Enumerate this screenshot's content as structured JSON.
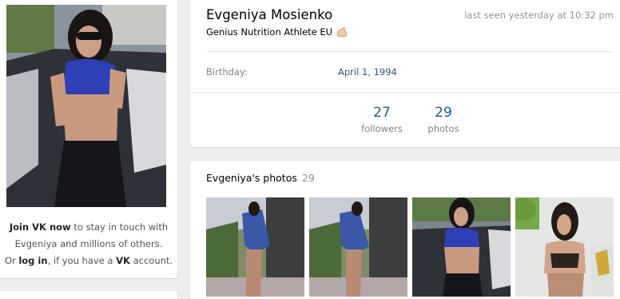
{
  "sidebar": {
    "join_strong": "Join VK now",
    "join_rest": " to stay in touch with",
    "line2": "Evgeniya and millions of others.",
    "line3_or": "Or ",
    "line3_login": "log in",
    "line3_mid": ", if you have a ",
    "line3_vk": "VK",
    "line3_end": " account."
  },
  "profile": {
    "name": "Evgeniya Mosienko",
    "status": "Genius Nutrition Athlete EU",
    "status_emoji": "muscle-emoji",
    "last_seen": "last seen yesterday at 10:32 pm",
    "birthday_label": "Birthday:",
    "birthday_value": "April 1, 1994",
    "counters": [
      {
        "number": "27",
        "label": "followers"
      },
      {
        "number": "29",
        "label": "photos"
      }
    ]
  },
  "photos": {
    "title": "Evgeniya's photos",
    "count": "29"
  },
  "colors": {
    "link": "#2a5885",
    "muted": "#828282",
    "background": "#edeef0"
  }
}
